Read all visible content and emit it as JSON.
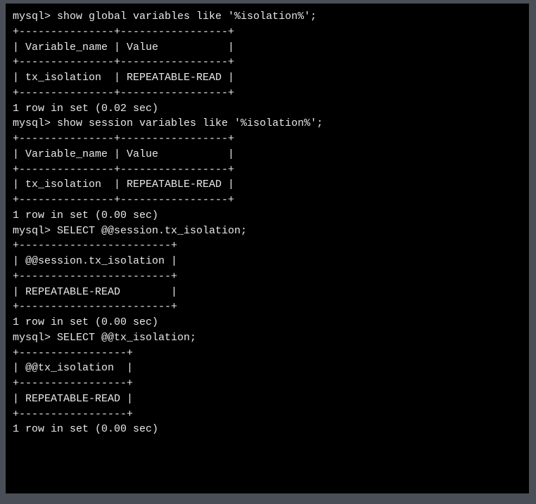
{
  "blocks": [
    {
      "prompt": "mysql> ",
      "command": "show global variables like '%isolation%';",
      "table": {
        "cols": [
          "Variable_name",
          "Value          "
        ],
        "widths": [
          15,
          17
        ],
        "rows": [
          [
            "tx_isolation ",
            "REPEATABLE-READ"
          ]
        ]
      },
      "footer": "1 row in set (0.02 sec)"
    },
    {
      "prompt": "mysql> ",
      "command": "show session variables like '%isolation%';",
      "table": {
        "cols": [
          "Variable_name",
          "Value          "
        ],
        "widths": [
          15,
          17
        ],
        "rows": [
          [
            "tx_isolation ",
            "REPEATABLE-READ"
          ]
        ]
      },
      "footer": "1 row in set (0.00 sec)"
    },
    {
      "prompt": "mysql> ",
      "command": "SELECT @@session.tx_isolation;",
      "table": {
        "cols": [
          "@@session.tx_isolation"
        ],
        "widths": [
          24
        ],
        "rows": [
          [
            "REPEATABLE-READ       "
          ]
        ]
      },
      "footer": "1 row in set (0.00 sec)"
    },
    {
      "prompt": "mysql> ",
      "command": "SELECT @@tx_isolation;",
      "table": {
        "cols": [
          "@@tx_isolation "
        ],
        "widths": [
          17
        ],
        "rows": [
          [
            "REPEATABLE-READ"
          ]
        ]
      },
      "footer": "1 row in set (0.00 sec)"
    }
  ]
}
